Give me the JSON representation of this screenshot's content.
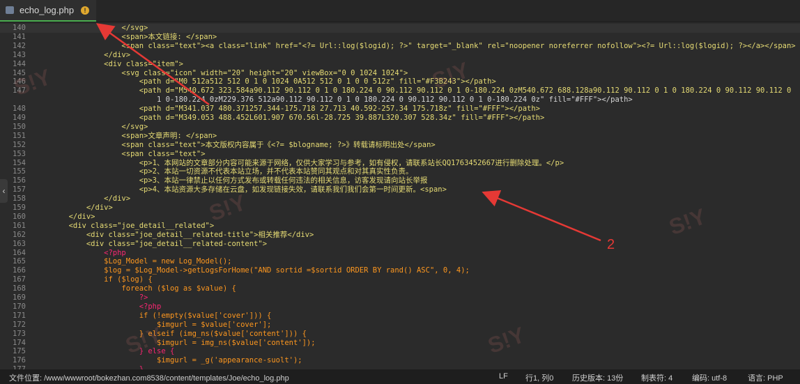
{
  "tab": {
    "filename": "echo_log.php",
    "badge": "!"
  },
  "status": {
    "path": "文件位置: /www/wwwroot/bokezhan.com8538/content/templates/Joe/echo_log.php",
    "eol": "LF",
    "position": "行1, 列0",
    "history": "历史版本: 13份",
    "tab": "制表符: 4",
    "encoding": "编码: utf-8",
    "language": "语言: PHP"
  },
  "annotation": {
    "label": "2",
    "color": "#e53935"
  },
  "watermark": "S!Y",
  "lines": [
    {
      "n": "140",
      "c": "                    </svg>"
    },
    {
      "n": "141",
      "c": "                    <span>本文链接: </span>"
    },
    {
      "n": "142",
      "c": "                    <span class=\"text\"><a class=\"link\" href=\"<?= Url::log($logid); ?>\" target=\"_blank\" rel=\"noopener noreferrer nofollow\"><?= Url::log($logid); ?></a></span>"
    },
    {
      "n": "143",
      "c": "                </div>"
    },
    {
      "n": "144",
      "c": "                <div class=\"item\">"
    },
    {
      "n": "145",
      "c": "                    <svg class=\"icon\" width=\"20\" height=\"20\" viewBox=\"0 0 1024 1024\">"
    },
    {
      "n": "146",
      "c": "                        <path d=\"M0 512a512 512 0 1 0 1024 0A512 512 0 1 0 0 512z\" fill=\"#F3B243\"></path>"
    },
    {
      "n": "147",
      "c": "                        <path d=\"M540.672 323.584a90.112 90.112 0 1 0 180.224 0 90.112 90.112 0 1 0-180.224 0zM540.672 688.128a90.112 90.112 0 1 0 180.224 0 90.112 90.112 0"
    },
    {
      "n": "",
      "c": "                            1 0-180.224 0zM229.376 512a90.112 90.112 0 1 0 180.224 0 90.112 90.112 0 1 0-180.224 0z\" fill=\"#FFF\"></path>"
    },
    {
      "n": "148",
      "c": "                        <path d=\"M341.037 480.371257.344-175.718 27.713 40.592-257.34 175.718z\" fill=\"#FFF\"></path>"
    },
    {
      "n": "149",
      "c": "                        <path d=\"M349.053 488.452L601.907 670.56l-28.725 39.887L320.307 528.34z\" fill=\"#FFF\"></path>"
    },
    {
      "n": "150",
      "c": "                    </svg>"
    },
    {
      "n": "151",
      "c": "                    <span>文章声明: </span>"
    },
    {
      "n": "152",
      "c": "                    <span class=\"text\">本文版权内容属于《<?= $blogname; ?>》转载请标明出处</span>"
    },
    {
      "n": "153",
      "c": "                    <span class=\"text\">"
    },
    {
      "n": "154",
      "c": "                        <p>1、本网站的文章部分内容可能来源于网络，仅供大家学习与参考，如有侵权，请联系站长QQ1763452667进行删除处理。</p>"
    },
    {
      "n": "155",
      "c": "                        <p>2、本站一切资源不代表本站立场，并不代表本站赞同其观点和对其真实性负责。"
    },
    {
      "n": "156",
      "c": "                        <p>3、本站一律禁止以任何方式发布或转载任何违法的相关信息，访客发现请向站长举报"
    },
    {
      "n": "157",
      "c": "                        <p>4、本站资源大多存储在云盘，如发现链接失效，请联系我们我们会第一时间更新。<span>"
    },
    {
      "n": "158",
      "c": "                </div>"
    },
    {
      "n": "159",
      "c": "            </div>"
    },
    {
      "n": "160",
      "c": "        </div>"
    },
    {
      "n": "161",
      "c": "        <div class=\"joe_detail__related\">"
    },
    {
      "n": "162",
      "c": "            <div class=\"joe_detail__related-title\">相关推荐</div>"
    },
    {
      "n": "163",
      "c": "            <div class=\"joe_detail__related-content\">"
    },
    {
      "n": "164",
      "c": "                <?php"
    },
    {
      "n": "165",
      "c": "                $Log_Model = new Log_Model();"
    },
    {
      "n": "166",
      "c": "                $log = $Log_Model->getLogsForHome(\"AND sortid =$sortid ORDER BY rand() ASC\", 0, 4);"
    },
    {
      "n": "167",
      "c": "                if ($log) {"
    },
    {
      "n": "168",
      "c": "                    foreach ($log as $value) {"
    },
    {
      "n": "169",
      "c": "                        ?>"
    },
    {
      "n": "170",
      "c": "                        <?php"
    },
    {
      "n": "171",
      "c": "                        if (!empty($value['cover'])) {"
    },
    {
      "n": "172",
      "c": "                            $imgurl = $value['cover'];"
    },
    {
      "n": "173",
      "c": "                        } elseif (img_ns($value['content'])) {"
    },
    {
      "n": "174",
      "c": "                            $imgurl = img_ns($value['content']);"
    },
    {
      "n": "175",
      "c": "                        } else {"
    },
    {
      "n": "176",
      "c": "                            $imgurl = _g('appearance-suolt');"
    },
    {
      "n": "177",
      "c": "                        }"
    }
  ]
}
